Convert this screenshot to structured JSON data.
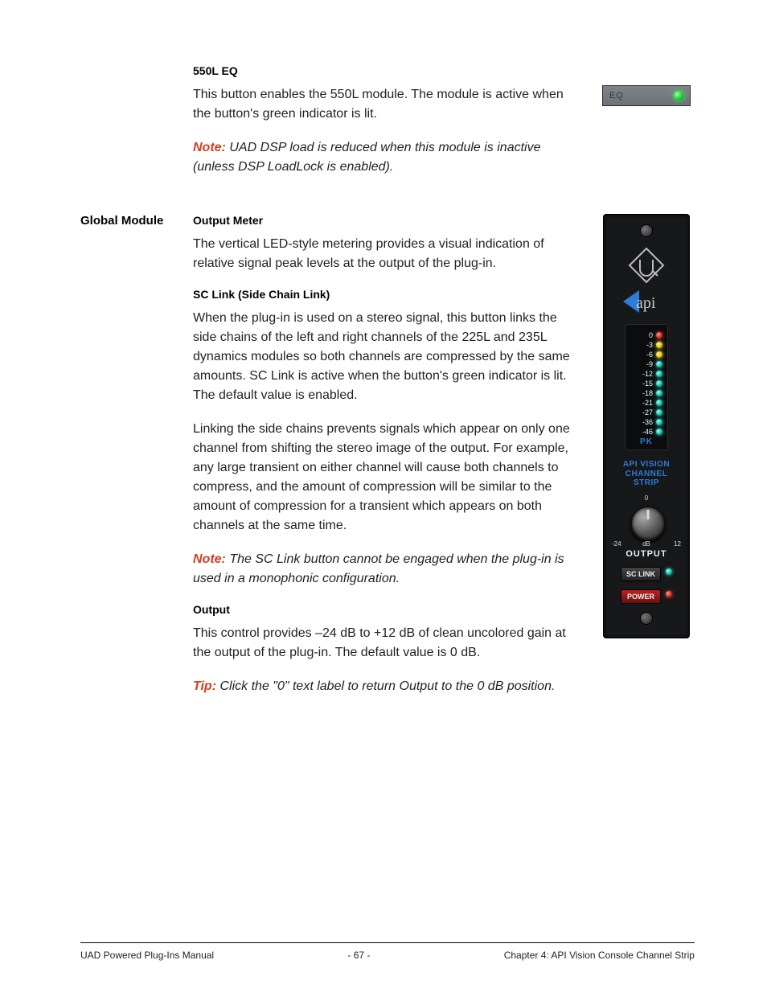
{
  "sections": {
    "eq": {
      "heading": "550L EQ",
      "body1": "This button enables the 550L module. The module is active when the button's green indicator is lit.",
      "noteLabel": "Note:",
      "note": "UAD DSP load is reduced when this module is inactive (unless DSP LoadLock is enabled).",
      "buttonLabel": "EQ"
    },
    "global": {
      "sidebar": "Global Module",
      "outputMeter": {
        "heading": "Output Meter",
        "body": "The vertical LED-style metering provides a visual indication of relative signal peak levels at the output of the plug-in."
      },
      "scLink": {
        "heading": "SC Link (Side Chain Link)",
        "body1": "When the plug-in is used on a stereo signal, this button links the side chains of the left and right channels of the 225L and 235L dynamics modules so both channels are compressed by the same amounts. SC Link is active when the button's green indicator is lit. The default value is enabled.",
        "body2": "Linking the side chains prevents signals which appear on only one channel from shifting the stereo image of the output. For example, any large transient on either channel will cause both channels to compress, and the amount of compression will be similar to the amount of compression for a transient which appears on both channels at the same time.",
        "noteLabel": "Note:",
        "note": "The SC Link button cannot be engaged when the plug-in is used in a monophonic configuration."
      },
      "output": {
        "heading": "Output",
        "body": "This control provides –24 dB to +12 dB of clean uncolored gain at the output of the plug-in. The default value is 0 dB.",
        "tipLabel": "Tip:",
        "tip": "Click the \"0\" text label to return Output to the 0 dB position."
      }
    }
  },
  "strip": {
    "meterValues": [
      "0",
      "-3",
      "-6",
      "-9",
      "-12",
      "-15",
      "-18",
      "-21",
      "-27",
      "-36",
      "-46"
    ],
    "meterColors": [
      "red",
      "amber",
      "amber",
      "teal",
      "teal",
      "teal",
      "teal",
      "teal",
      "teal",
      "teal",
      "teal"
    ],
    "pk": "PK",
    "titleLines": [
      "API VISION",
      "CHANNEL",
      "STRIP"
    ],
    "knob": {
      "zero": "0",
      "min": "-24",
      "unit": "dB",
      "max": "12",
      "label": "OUTPUT"
    },
    "scLink": "SC LINK",
    "power": "POWER"
  },
  "footer": {
    "left": "UAD Powered Plug-Ins Manual",
    "center": "- 67 -",
    "right": "Chapter 4: API Vision Console Channel Strip"
  }
}
